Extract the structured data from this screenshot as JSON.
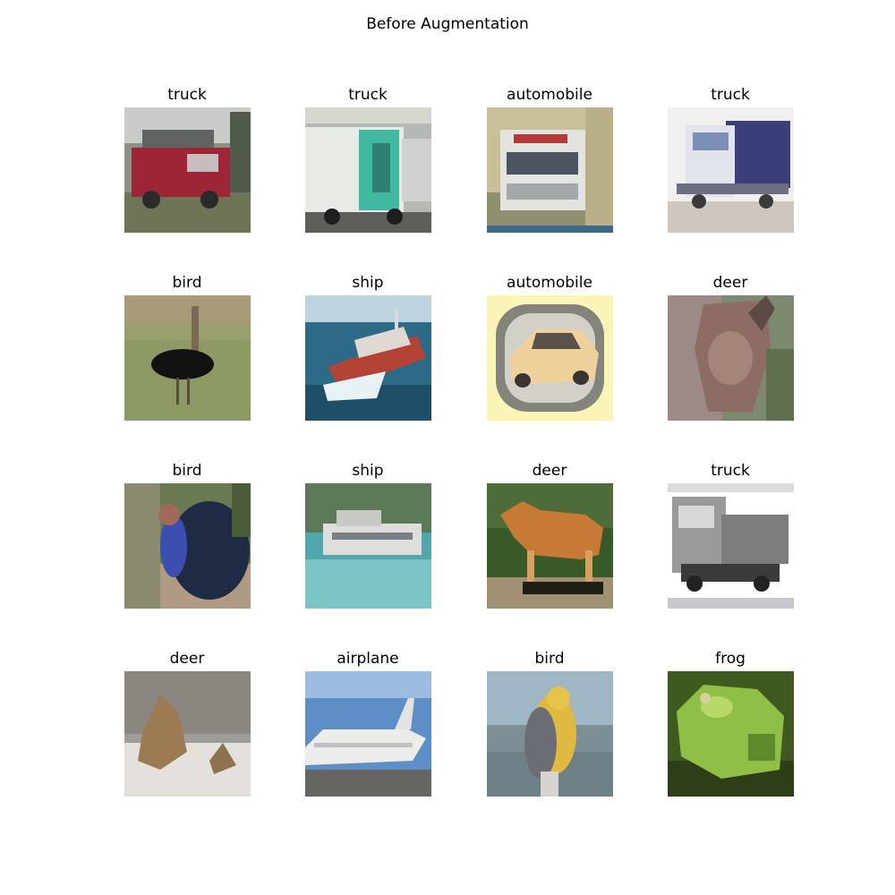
{
  "figure": {
    "title": "Before Augmentation"
  },
  "grid": {
    "rows": 4,
    "cols": 4,
    "cells": [
      {
        "label": "truck",
        "image": "red-fire-truck"
      },
      {
        "label": "truck",
        "image": "white-box-truck-teal-panel"
      },
      {
        "label": "automobile",
        "image": "white-ambulance-van-front"
      },
      {
        "label": "truck",
        "image": "blue-semi-truck"
      },
      {
        "label": "bird",
        "image": "black-ostrich-on-grass"
      },
      {
        "label": "ship",
        "image": "red-cargo-ship-on-sea"
      },
      {
        "label": "automobile",
        "image": "gold-sports-car-vignette"
      },
      {
        "label": "deer",
        "image": "deer-closeup"
      },
      {
        "label": "bird",
        "image": "dark-blue-rooster"
      },
      {
        "label": "ship",
        "image": "white-boat-on-water"
      },
      {
        "label": "deer",
        "image": "brown-dog-like-deer-standing"
      },
      {
        "label": "truck",
        "image": "grey-dump-truck-on-white"
      },
      {
        "label": "deer",
        "image": "deer-lying-in-snow"
      },
      {
        "label": "airplane",
        "image": "white-jet-on-tarmac"
      },
      {
        "label": "bird",
        "image": "yellow-breasted-songbird"
      },
      {
        "label": "frog",
        "image": "green-frog"
      }
    ]
  }
}
